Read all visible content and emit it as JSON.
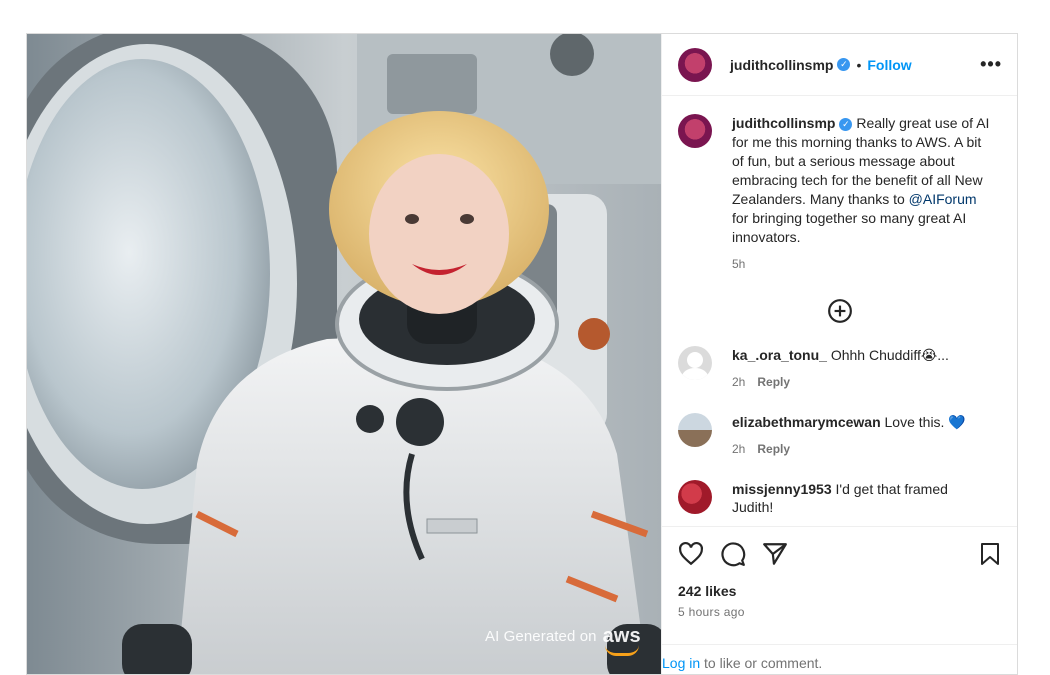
{
  "post": {
    "username": "judithcollinsmp",
    "follow_label": "Follow",
    "dot": "•",
    "more_label": "•••",
    "caption": {
      "username": "judithcollinsmp",
      "text_before": "Really great use of AI for me this morning thanks to AWS. A bit of fun, but a serious message about embracing tech for the benefit of all New Zealanders. Many thanks to ",
      "mention": "@AIForum",
      "text_after": " for bringing together so many great AI innovators.",
      "time": "5h"
    },
    "comments": [
      {
        "username": "ka_.ora_tonu_",
        "text": "Ohhh Chuddiff😭...",
        "time": "2h",
        "reply_label": "Reply"
      },
      {
        "username": "elizabethmarymcewan",
        "text": "Love this. ",
        "emoji": "💙",
        "time": "2h",
        "reply_label": "Reply"
      },
      {
        "username": "missjenny1953",
        "text": "I'd get that framed Judith!",
        "time": "",
        "reply_label": ""
      }
    ],
    "likes": "242 likes",
    "posted_ago": "5 hours ago",
    "login_link": "Log in",
    "login_rest": " to like or comment."
  },
  "media": {
    "ai_label": "AI Generated on",
    "aws_logo": "aws"
  },
  "icons": [
    "more-options-icon",
    "verified-icon",
    "add-comment-icon",
    "heart-icon",
    "comment-icon",
    "share-icon",
    "bookmark-icon"
  ],
  "colors": {
    "accent": "#0095f6",
    "verified": "#3897f0",
    "aws_orange": "#f7a11a"
  }
}
